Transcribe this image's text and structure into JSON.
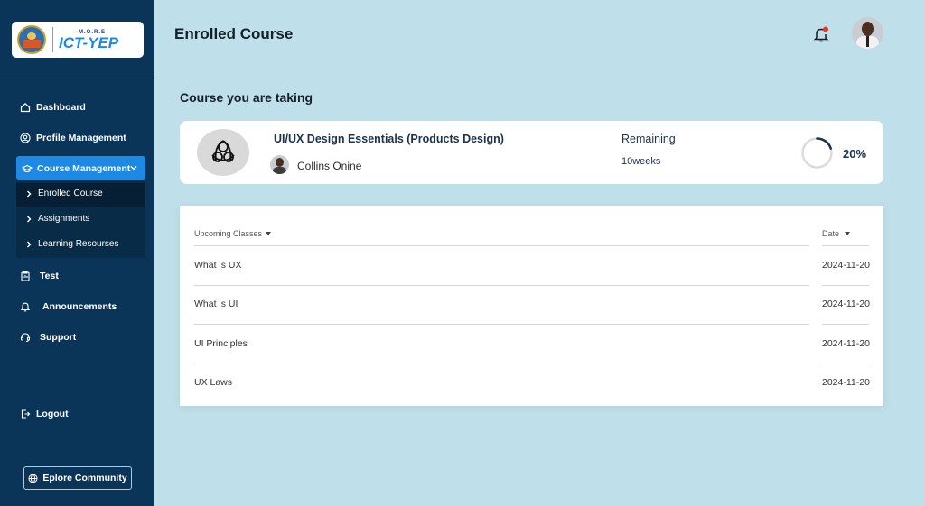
{
  "brand": {
    "small": "M.O.R.E",
    "main": "ICT-YEP"
  },
  "sidebar": {
    "items": [
      {
        "label": "Dashboard",
        "icon": "home-icon"
      },
      {
        "label": "Profile Management",
        "icon": "user-circle-icon"
      },
      {
        "label": "Course Management",
        "icon": "graduation-cap-icon"
      },
      {
        "label": "Test",
        "icon": "clipboard-icon"
      },
      {
        "label": "Announcements",
        "icon": "bell-icon"
      },
      {
        "label": "Support",
        "icon": "headset-icon"
      },
      {
        "label": "Logout",
        "icon": "logout-icon"
      }
    ],
    "submenu": [
      {
        "label": "Enrolled Course"
      },
      {
        "label": "Assignments"
      },
      {
        "label": "Learning Resourses"
      }
    ],
    "explore_label": "Eplore Community"
  },
  "header": {
    "title": "Enrolled Course"
  },
  "main": {
    "section_heading": "Course you are taking",
    "course": {
      "title": "UI/UX Design Essentials (Products Design)",
      "instructor": "Collins Onine",
      "remaining_label": "Remaining",
      "remaining_value": "10weeks",
      "progress_percent": 20,
      "progress_text": "20%"
    },
    "table": {
      "col_classes": "Upcoming Classes",
      "col_date": "Date",
      "rows": [
        {
          "name": "What is UX",
          "date": "2024-11-20"
        },
        {
          "name": "What is UI",
          "date": "2024-11-20"
        },
        {
          "name": "UI Principles",
          "date": "2024-11-20"
        },
        {
          "name": "UX Laws",
          "date": "2024-11-20"
        }
      ]
    }
  },
  "colors": {
    "sidebar_bg": "#0b3558",
    "accent": "#1e88e5",
    "page_bg": "#bfe0ea",
    "notification_dot": "#e53935"
  }
}
